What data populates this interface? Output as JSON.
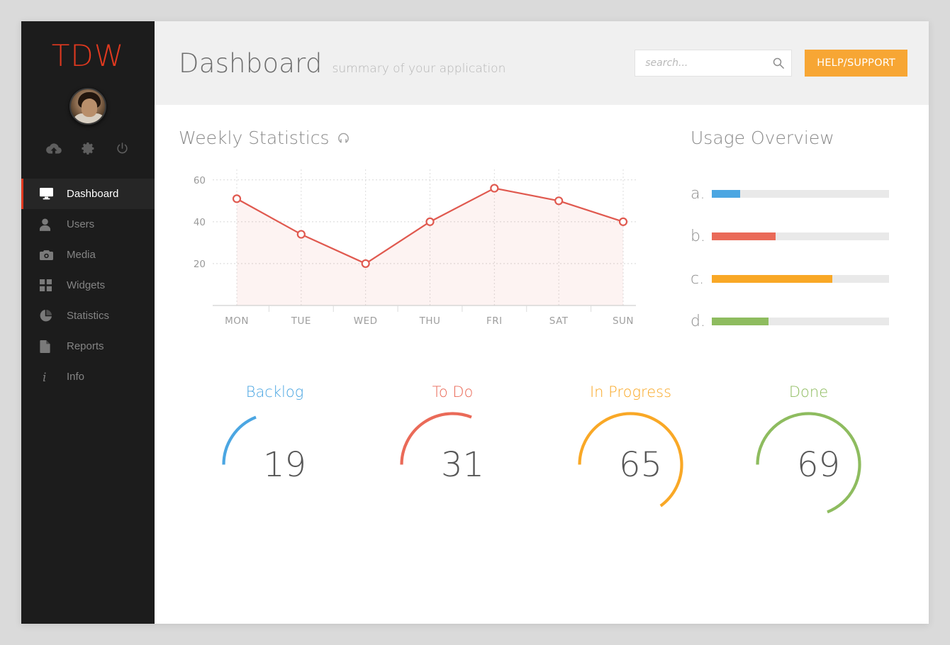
{
  "brand": {
    "logo_text": "TDW"
  },
  "sidebar": {
    "quick_icons": [
      {
        "name": "cloud-upload-icon",
        "label": "cloud-upload"
      },
      {
        "name": "gear-icon",
        "label": "settings"
      },
      {
        "name": "power-icon",
        "label": "power"
      }
    ],
    "items": [
      {
        "label": "Dashboard",
        "icon": "monitor-icon",
        "active": true
      },
      {
        "label": "Users",
        "icon": "user-icon",
        "active": false
      },
      {
        "label": "Media",
        "icon": "camera-icon",
        "active": false
      },
      {
        "label": "Widgets",
        "icon": "grid-icon",
        "active": false
      },
      {
        "label": "Statistics",
        "icon": "pie-chart-icon",
        "active": false
      },
      {
        "label": "Reports",
        "icon": "document-icon",
        "active": false
      },
      {
        "label": "Info",
        "icon": "info-icon",
        "active": false
      }
    ]
  },
  "header": {
    "title": "Dashboard",
    "subtitle": "summary of your application",
    "search_placeholder": "search...",
    "search_value": "",
    "help_button": "HELP/SUPPORT"
  },
  "weekly": {
    "title": "Weekly Statistics",
    "refresh_icon": "refresh-icon"
  },
  "usage": {
    "title": "Usage Overview",
    "rows": [
      {
        "label": "a.",
        "percent": 16,
        "color": "#4ba6e2"
      },
      {
        "label": "b.",
        "percent": 36,
        "color": "#ea6a58"
      },
      {
        "label": "c.",
        "percent": 68,
        "color": "#f9a826"
      },
      {
        "label": "d.",
        "percent": 32,
        "color": "#8ebc5f"
      }
    ]
  },
  "gauges": [
    {
      "label": "Backlog",
      "value": 19,
      "color": "#4ba6e2"
    },
    {
      "label": "To Do",
      "value": 31,
      "color": "#ea6a58"
    },
    {
      "label": "In Progress",
      "value": 65,
      "color": "#f9a826"
    },
    {
      "label": "Done",
      "value": 69,
      "color": "#8ebc5f"
    }
  ],
  "colors": {
    "accent_red": "#e0391f",
    "orange": "#f7a634",
    "blue": "#4ba6e2",
    "red": "#ea6a58",
    "green": "#8ebc5f",
    "sidebar_bg": "#1c1c1c",
    "page_bg": "#dadada"
  },
  "chart_data": {
    "type": "line",
    "title": "Weekly Statistics",
    "categories": [
      "MON",
      "TUE",
      "WED",
      "THU",
      "FRI",
      "SAT",
      "SUN"
    ],
    "values": [
      51,
      34,
      20,
      40,
      56,
      50,
      40
    ],
    "yticks": [
      20,
      40,
      60
    ],
    "ylim": [
      0,
      65
    ],
    "xlabel": "",
    "ylabel": "",
    "grid": true,
    "legend": "none",
    "line_color": "#e0594f",
    "fill_color": "rgba(232,89,79,0.08)",
    "marker": "open-circle"
  }
}
